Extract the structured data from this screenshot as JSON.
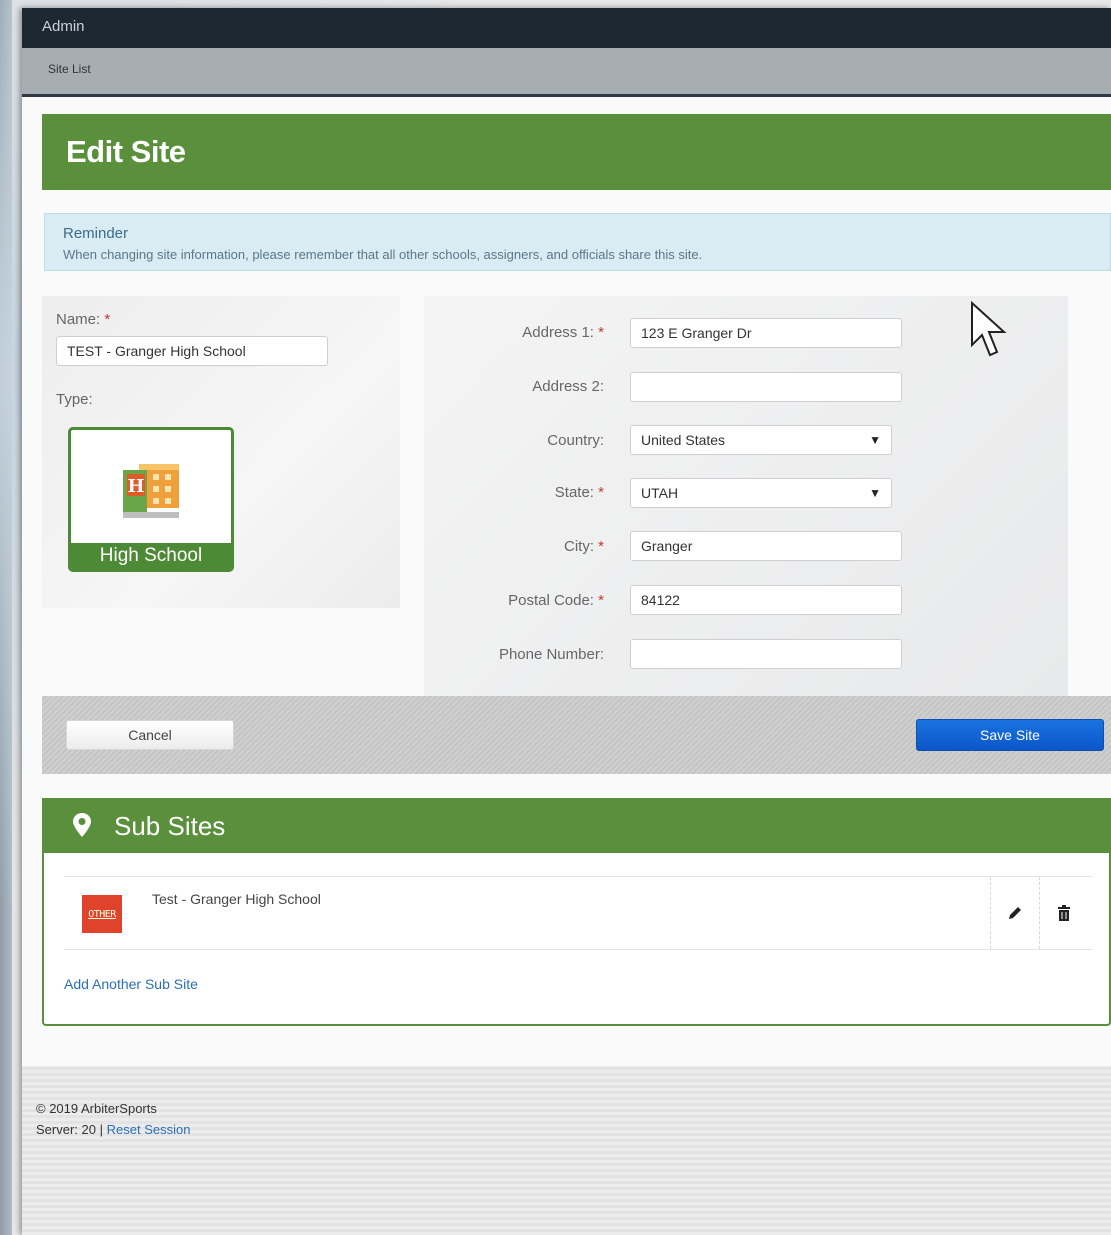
{
  "topbar": {
    "title": "Admin"
  },
  "subbar": {
    "breadcrumb": "Site List"
  },
  "page": {
    "title": "Edit Site"
  },
  "reminder": {
    "title": "Reminder",
    "text": "When changing site information, please remember that all other schools, assigners, and officials share this site."
  },
  "left": {
    "name_label": "Name:",
    "name_value": "TEST - Granger High School",
    "type_label": "Type:",
    "type_card_label": "High School",
    "type_icon": "school-building-icon"
  },
  "right": {
    "address1_label": "Address 1:",
    "address1_value": "123 E Granger Dr",
    "address2_label": "Address 2:",
    "address2_value": "",
    "country_label": "Country:",
    "country_value": "United States",
    "state_label": "State:",
    "state_value": "UTAH",
    "city_label": "City:",
    "city_value": "Granger",
    "postal_label": "Postal Code:",
    "postal_value": "84122",
    "phone_label": "Phone Number:",
    "phone_value": ""
  },
  "required_marker": "*",
  "actions": {
    "cancel_label": "Cancel",
    "save_label": "Save Site"
  },
  "subsites": {
    "title": "Sub Sites",
    "items": [
      {
        "badge": "OTHER",
        "name": "Test - Granger High School"
      }
    ],
    "add_label": "Add Another Sub Site"
  },
  "footer": {
    "copyright": "© 2019 ArbiterSports",
    "server": "Server: 20",
    "separator": "|",
    "reset_label": "Reset Session"
  },
  "colors": {
    "header_green": "#5a8f3c",
    "topbar": "#1d2833",
    "save_blue": "#0b57c9",
    "link_blue": "#2a6fb8",
    "required_red": "#c0392b"
  }
}
